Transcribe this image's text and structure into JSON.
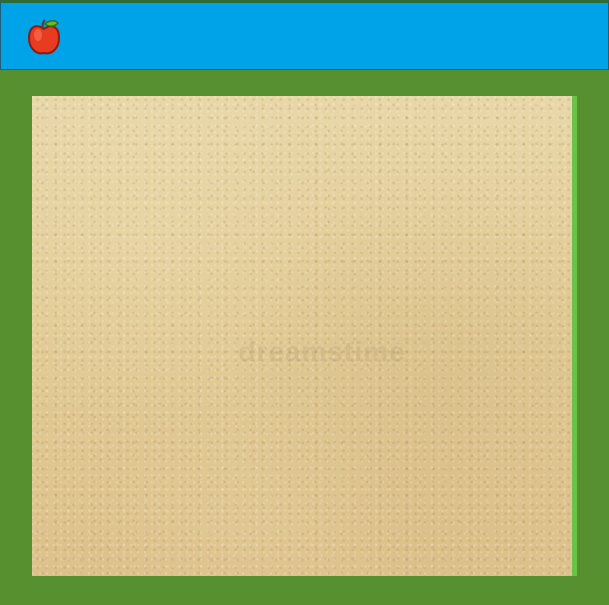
{
  "game": {
    "watermark": "dreamstime",
    "icon": "apple-icon"
  },
  "colors": {
    "top_bar": "#00a2e8",
    "frame": "#56902f",
    "sand": "#e2cb95",
    "edge": "#69c34a",
    "apple": "#e83b20"
  }
}
